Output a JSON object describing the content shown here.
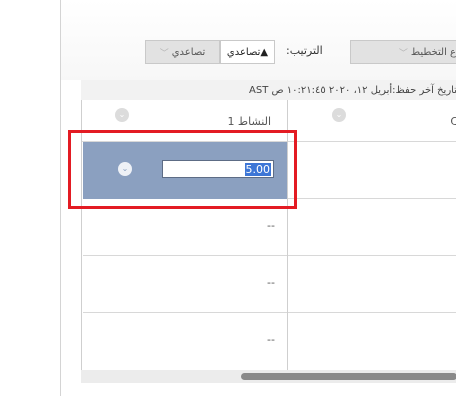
{
  "toolbar": {
    "plan_sort_label": "ع التخطيط",
    "ascending_label": "▲تصاعدي",
    "sort_label": "الترتيب:"
  },
  "saved_info": "تاريخ آخر حفظ:أبريل ١٢، ٢٠٢٠ ١٠:٢١:٤٥ ص AST",
  "grid": {
    "activity_header": "النشاط 1",
    "right_header_fragment": "C",
    "selected_value": "5.00",
    "empty_value": "--"
  },
  "colors": {
    "selection": "#8ba0c0",
    "highlight_box": "#e31b23",
    "text_selection": "#3d76d6"
  }
}
